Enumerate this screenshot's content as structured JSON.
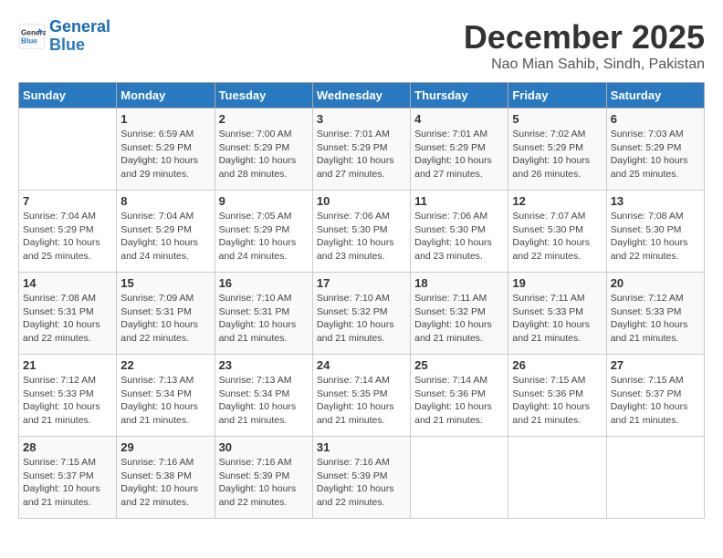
{
  "logo": {
    "line1": "General",
    "line2": "Blue"
  },
  "title": "December 2025",
  "location": "Nao Mian Sahib, Sindh, Pakistan",
  "weekdays": [
    "Sunday",
    "Monday",
    "Tuesday",
    "Wednesday",
    "Thursday",
    "Friday",
    "Saturday"
  ],
  "weeks": [
    [
      {
        "day": "",
        "info": ""
      },
      {
        "day": "1",
        "info": "Sunrise: 6:59 AM\nSunset: 5:29 PM\nDaylight: 10 hours\nand 29 minutes."
      },
      {
        "day": "2",
        "info": "Sunrise: 7:00 AM\nSunset: 5:29 PM\nDaylight: 10 hours\nand 28 minutes."
      },
      {
        "day": "3",
        "info": "Sunrise: 7:01 AM\nSunset: 5:29 PM\nDaylight: 10 hours\nand 27 minutes."
      },
      {
        "day": "4",
        "info": "Sunrise: 7:01 AM\nSunset: 5:29 PM\nDaylight: 10 hours\nand 27 minutes."
      },
      {
        "day": "5",
        "info": "Sunrise: 7:02 AM\nSunset: 5:29 PM\nDaylight: 10 hours\nand 26 minutes."
      },
      {
        "day": "6",
        "info": "Sunrise: 7:03 AM\nSunset: 5:29 PM\nDaylight: 10 hours\nand 25 minutes."
      }
    ],
    [
      {
        "day": "7",
        "info": "Sunrise: 7:04 AM\nSunset: 5:29 PM\nDaylight: 10 hours\nand 25 minutes."
      },
      {
        "day": "8",
        "info": "Sunrise: 7:04 AM\nSunset: 5:29 PM\nDaylight: 10 hours\nand 24 minutes."
      },
      {
        "day": "9",
        "info": "Sunrise: 7:05 AM\nSunset: 5:29 PM\nDaylight: 10 hours\nand 24 minutes."
      },
      {
        "day": "10",
        "info": "Sunrise: 7:06 AM\nSunset: 5:30 PM\nDaylight: 10 hours\nand 23 minutes."
      },
      {
        "day": "11",
        "info": "Sunrise: 7:06 AM\nSunset: 5:30 PM\nDaylight: 10 hours\nand 23 minutes."
      },
      {
        "day": "12",
        "info": "Sunrise: 7:07 AM\nSunset: 5:30 PM\nDaylight: 10 hours\nand 22 minutes."
      },
      {
        "day": "13",
        "info": "Sunrise: 7:08 AM\nSunset: 5:30 PM\nDaylight: 10 hours\nand 22 minutes."
      }
    ],
    [
      {
        "day": "14",
        "info": "Sunrise: 7:08 AM\nSunset: 5:31 PM\nDaylight: 10 hours\nand 22 minutes."
      },
      {
        "day": "15",
        "info": "Sunrise: 7:09 AM\nSunset: 5:31 PM\nDaylight: 10 hours\nand 22 minutes."
      },
      {
        "day": "16",
        "info": "Sunrise: 7:10 AM\nSunset: 5:31 PM\nDaylight: 10 hours\nand 21 minutes."
      },
      {
        "day": "17",
        "info": "Sunrise: 7:10 AM\nSunset: 5:32 PM\nDaylight: 10 hours\nand 21 minutes."
      },
      {
        "day": "18",
        "info": "Sunrise: 7:11 AM\nSunset: 5:32 PM\nDaylight: 10 hours\nand 21 minutes."
      },
      {
        "day": "19",
        "info": "Sunrise: 7:11 AM\nSunset: 5:33 PM\nDaylight: 10 hours\nand 21 minutes."
      },
      {
        "day": "20",
        "info": "Sunrise: 7:12 AM\nSunset: 5:33 PM\nDaylight: 10 hours\nand 21 minutes."
      }
    ],
    [
      {
        "day": "21",
        "info": "Sunrise: 7:12 AM\nSunset: 5:33 PM\nDaylight: 10 hours\nand 21 minutes."
      },
      {
        "day": "22",
        "info": "Sunrise: 7:13 AM\nSunset: 5:34 PM\nDaylight: 10 hours\nand 21 minutes."
      },
      {
        "day": "23",
        "info": "Sunrise: 7:13 AM\nSunset: 5:34 PM\nDaylight: 10 hours\nand 21 minutes."
      },
      {
        "day": "24",
        "info": "Sunrise: 7:14 AM\nSunset: 5:35 PM\nDaylight: 10 hours\nand 21 minutes."
      },
      {
        "day": "25",
        "info": "Sunrise: 7:14 AM\nSunset: 5:36 PM\nDaylight: 10 hours\nand 21 minutes."
      },
      {
        "day": "26",
        "info": "Sunrise: 7:15 AM\nSunset: 5:36 PM\nDaylight: 10 hours\nand 21 minutes."
      },
      {
        "day": "27",
        "info": "Sunrise: 7:15 AM\nSunset: 5:37 PM\nDaylight: 10 hours\nand 21 minutes."
      }
    ],
    [
      {
        "day": "28",
        "info": "Sunrise: 7:15 AM\nSunset: 5:37 PM\nDaylight: 10 hours\nand 21 minutes."
      },
      {
        "day": "29",
        "info": "Sunrise: 7:16 AM\nSunset: 5:38 PM\nDaylight: 10 hours\nand 22 minutes."
      },
      {
        "day": "30",
        "info": "Sunrise: 7:16 AM\nSunset: 5:39 PM\nDaylight: 10 hours\nand 22 minutes."
      },
      {
        "day": "31",
        "info": "Sunrise: 7:16 AM\nSunset: 5:39 PM\nDaylight: 10 hours\nand 22 minutes."
      },
      {
        "day": "",
        "info": ""
      },
      {
        "day": "",
        "info": ""
      },
      {
        "day": "",
        "info": ""
      }
    ]
  ]
}
